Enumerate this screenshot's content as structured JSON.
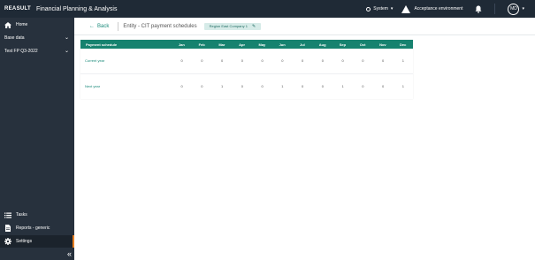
{
  "topbar": {
    "brand": "REASULT",
    "app_title": "Financial Planning & Analysis",
    "system_label": "System",
    "environment_label": "Acceptance environment",
    "user_initials": "MD"
  },
  "sidebar": {
    "items": [
      {
        "label": "Home",
        "icon": "home-icon"
      },
      {
        "label": "Base data",
        "icon": "",
        "chevron": "⌄"
      },
      {
        "label": "Test FP Q3-2022",
        "icon": "",
        "chevron": "⌄"
      },
      {
        "label": "Tasks",
        "icon": "list-icon"
      },
      {
        "label": "Reports - generic",
        "icon": "document-icon"
      },
      {
        "label": "Settings",
        "icon": "gear-icon"
      }
    ],
    "collapse_label": "«"
  },
  "header": {
    "back_label": "Back",
    "title": "Entity - CIT payment schedules",
    "entity_chip": "Region East Company 1"
  },
  "table": {
    "columns": [
      "Payment schedule",
      "Jan",
      "Feb",
      "Mar",
      "Apr",
      "May",
      "Jun",
      "Jul",
      "Aug",
      "Sep",
      "Oct",
      "Nov",
      "Dec"
    ],
    "rows": [
      {
        "label": "Current year",
        "values": [
          "0",
          "0",
          "0",
          "0",
          "0",
          "0",
          "0",
          "0",
          "0",
          "0",
          "0",
          "1"
        ]
      },
      {
        "label": "Next year",
        "values": [
          "0",
          "0",
          "1",
          "0",
          "0",
          "1",
          "0",
          "0",
          "1",
          "0",
          "0",
          "1"
        ]
      }
    ]
  },
  "colors": {
    "topbar": "#1f2a36",
    "sidebar": "#27313d",
    "accent": "#16826f",
    "active_indicator": "#e67e22"
  }
}
